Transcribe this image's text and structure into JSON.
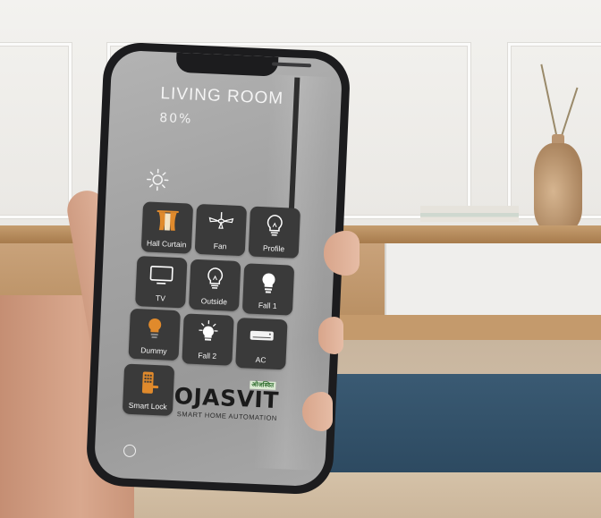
{
  "screen": {
    "room_title": "LIVING ROOM",
    "room_level": "80%",
    "icons": {
      "sun": "sun-icon",
      "home": "home-indicator"
    }
  },
  "tiles": [
    {
      "id": "hall-curtain",
      "label": "Hall Curtain",
      "icon": "curtain-icon"
    },
    {
      "id": "fan",
      "label": "Fan",
      "icon": "ceiling-fan-icon"
    },
    {
      "id": "profile",
      "label": "Profile",
      "icon": "bulb-outline-icon"
    },
    {
      "id": "tv",
      "label": "TV",
      "icon": "tv-icon"
    },
    {
      "id": "outside",
      "label": "Outside",
      "icon": "bulb-outline-icon"
    },
    {
      "id": "fall-1",
      "label": "Fall 1",
      "icon": "bulb-white-icon"
    },
    {
      "id": "dummy",
      "label": "Dummy",
      "icon": "bulb-orange-icon"
    },
    {
      "id": "fall-2",
      "label": "Fall  2",
      "icon": "bulb-rays-icon"
    },
    {
      "id": "ac",
      "label": "AC",
      "icon": "air-conditioner-icon"
    },
    {
      "id": "smart-lock",
      "label": "Smart Lock",
      "icon": "keypad-lock-icon"
    }
  ],
  "brand": {
    "name": "OJASVIT",
    "tagline": "SMART HOME AUTOMATION",
    "hindi": "ओजस्वित"
  },
  "colors": {
    "tile_bg": "#3a3a3a",
    "accent_orange": "#e08a2c",
    "brand_green": "#2c6b2c"
  }
}
